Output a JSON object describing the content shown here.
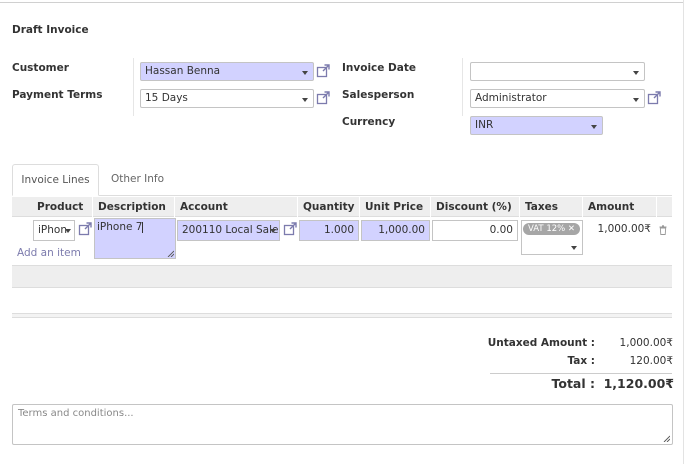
{
  "header": {
    "title": "Draft Invoice"
  },
  "form": {
    "customer_label": "Customer",
    "customer_value": "Hassan Benna",
    "payment_terms_label": "Payment Terms",
    "payment_terms_value": "15 Days",
    "invoice_date_label": "Invoice Date",
    "invoice_date_value": "",
    "salesperson_label": "Salesperson",
    "salesperson_value": "Administrator",
    "currency_label": "Currency",
    "currency_value": "INR"
  },
  "tabs": [
    {
      "label": "Invoice Lines",
      "active": true
    },
    {
      "label": "Other Info",
      "active": false
    }
  ],
  "lines": {
    "columns": [
      "Product",
      "Description",
      "Account",
      "Quantity",
      "Unit Price",
      "Discount (%)",
      "Taxes",
      "Amount"
    ],
    "rows": [
      {
        "product": "iPhon",
        "description": "iPhone 7",
        "account": "200110 Local Sale",
        "quantity": "1.000",
        "unit_price": "1,000.00",
        "discount": "0.00",
        "tax_tag": "VAT 12%",
        "amount": "1,000.00₹"
      }
    ],
    "add_item_label": "Add an item"
  },
  "totals": {
    "untaxed_label": "Untaxed Amount :",
    "untaxed_value": "1,000.00₹",
    "tax_label": "Tax :",
    "tax_value": "120.00₹",
    "total_label": "Total :",
    "total_value": "1,120.00₹"
  },
  "terms": {
    "placeholder": "Terms and conditions..."
  },
  "colors": {
    "required_field": "#d2d2ff",
    "link": "#7c7bad",
    "header_bg": "#eeeeee"
  }
}
